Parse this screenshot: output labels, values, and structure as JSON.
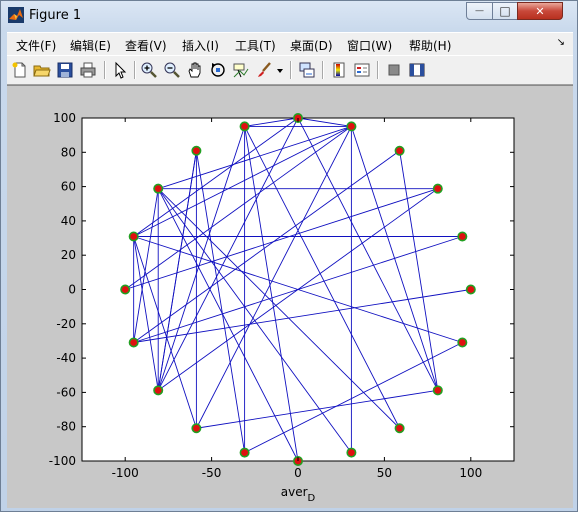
{
  "window": {
    "title": "Figure 1",
    "accent": "#c8483a",
    "min_glyph": "—",
    "max_glyph": "□",
    "close_glyph": "✕"
  },
  "menubar": {
    "items": [
      {
        "label": "文件(F)"
      },
      {
        "label": "编辑(E)"
      },
      {
        "label": "查看(V)"
      },
      {
        "label": "插入(I)"
      },
      {
        "label": "工具(T)"
      },
      {
        "label": "桌面(D)"
      },
      {
        "label": "窗口(W)"
      },
      {
        "label": "帮助(H)"
      }
    ],
    "dock_glyph": "↘"
  },
  "toolbar": {
    "icons": [
      "new-figure-icon",
      "open-file-icon",
      "save-icon",
      "print-icon",
      "edit-plot-arrow-icon",
      "zoom-in-icon",
      "zoom-out-icon",
      "pan-hand-icon",
      "rotate-3d-icon",
      "data-cursor-icon",
      "brush-icon",
      "brush-dropdown-icon",
      "link-plot-icon",
      "colorbar-icon",
      "legend-icon",
      "hide-plot-tools-icon",
      "show-plot-tools-icon"
    ]
  },
  "chart_data": {
    "type": "scatter",
    "xlabel": "aver",
    "xlabel_subscript": "D",
    "xlim": [
      -125,
      125
    ],
    "ylim": [
      -100,
      100
    ],
    "xticks": [
      "-100",
      "-50",
      "0",
      "50",
      "100"
    ],
    "yticks": [
      "100",
      "80",
      "60",
      "40",
      "20",
      "0",
      "-20",
      "-40",
      "-60",
      "-80",
      "-100"
    ],
    "xtick_values": [
      -100,
      -50,
      0,
      50,
      100
    ],
    "ytick_values": [
      100,
      80,
      60,
      40,
      20,
      0,
      -20,
      -40,
      -60,
      -80,
      -100
    ],
    "grid": false,
    "node_fill": "#e01010",
    "node_edge": "#22a022",
    "edge_color": "#1010c0",
    "nodes": [
      {
        "x": 100,
        "y": 0
      },
      {
        "x": 95.1,
        "y": 30.9
      },
      {
        "x": 80.9,
        "y": 58.8
      },
      {
        "x": 58.8,
        "y": 80.9
      },
      {
        "x": 30.9,
        "y": 95.1
      },
      {
        "x": 0,
        "y": 100
      },
      {
        "x": -30.9,
        "y": 95.1
      },
      {
        "x": -58.8,
        "y": 80.9
      },
      {
        "x": -80.9,
        "y": 58.8
      },
      {
        "x": -95.1,
        "y": 30.9
      },
      {
        "x": -100,
        "y": 0
      },
      {
        "x": -95.1,
        "y": -30.9
      },
      {
        "x": -80.9,
        "y": -58.8
      },
      {
        "x": -58.8,
        "y": -80.9
      },
      {
        "x": -30.9,
        "y": -95.1
      },
      {
        "x": 0,
        "y": -100
      },
      {
        "x": 30.9,
        "y": -95.1
      },
      {
        "x": 58.8,
        "y": -80.9
      },
      {
        "x": 80.9,
        "y": -58.8
      },
      {
        "x": 95.1,
        "y": -30.9
      }
    ],
    "edges": [
      [
        5,
        4
      ],
      [
        6,
        4
      ],
      [
        5,
        6
      ],
      [
        6,
        12
      ],
      [
        6,
        14
      ],
      [
        6,
        15
      ],
      [
        6,
        17
      ],
      [
        5,
        12
      ],
      [
        5,
        9
      ],
      [
        5,
        18
      ],
      [
        4,
        18
      ],
      [
        4,
        13
      ],
      [
        4,
        16
      ],
      [
        3,
        18
      ],
      [
        3,
        11
      ],
      [
        2,
        8
      ],
      [
        2,
        12
      ],
      [
        2,
        10
      ],
      [
        1,
        9
      ],
      [
        1,
        11
      ],
      [
        0,
        11
      ],
      [
        19,
        9
      ],
      [
        19,
        14
      ],
      [
        18,
        13
      ],
      [
        17,
        8
      ],
      [
        16,
        8
      ],
      [
        15,
        8
      ],
      [
        14,
        7
      ],
      [
        13,
        7
      ],
      [
        12,
        9
      ],
      [
        12,
        8
      ],
      [
        12,
        7
      ],
      [
        11,
        9
      ],
      [
        11,
        8
      ],
      [
        10,
        4
      ],
      [
        9,
        4
      ],
      [
        8,
        4
      ],
      [
        7,
        12
      ],
      [
        13,
        9
      ]
    ]
  }
}
